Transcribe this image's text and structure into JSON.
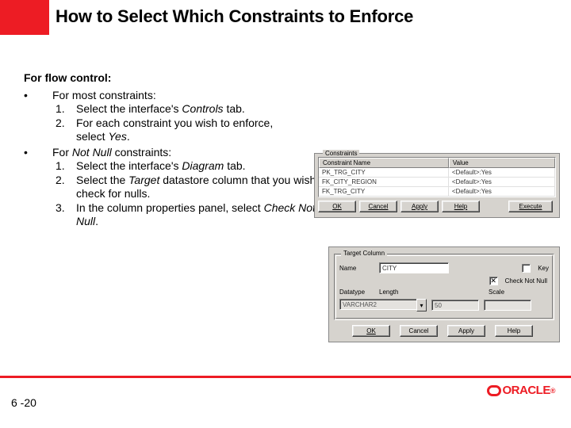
{
  "title": "How to Select Which Constraints to Enforce",
  "section_flow": "For flow control:",
  "bullet_a_label": "•",
  "bullet_a_text": "For most constraints:",
  "list_a": [
    {
      "n": "1.",
      "text_pre": "Select the interface's ",
      "text_em": "Controls",
      "text_post": " tab."
    },
    {
      "n": "2.",
      "text_pre": "For each constraint you wish to enforce, select ",
      "text_em": "Yes",
      "text_post": "."
    }
  ],
  "bullet_b_label": "•",
  "bullet_b_pre": "For ",
  "bullet_b_em": "Not Null",
  "bullet_b_post": " constraints:",
  "list_b": [
    {
      "n": "1.",
      "text_pre": "Select the interface's ",
      "text_em": "Diagram",
      "text_post": " tab."
    },
    {
      "n": "2.",
      "text_pre": "Select the ",
      "text_em": "Target",
      "text_post": " datastore column that you wish to check for nulls."
    },
    {
      "n": "3.",
      "text_pre": "In the column properties panel, select ",
      "text_em": "Check Not Null",
      "text_post": "."
    }
  ],
  "constraints": {
    "group_label": "Constraints",
    "headers": {
      "name": "Constraint Name",
      "value": "Value"
    },
    "rows": [
      {
        "name": "PK_TRG_CITY",
        "value": "<Default>:Yes"
      },
      {
        "name": "FK_CITY_REGION",
        "value": "<Default>:Yes"
      },
      {
        "name": "FK_TRG_CITY",
        "value": "<Default>:Yes"
      }
    ],
    "buttons": {
      "ok": "OK",
      "cancel": "Cancel",
      "apply": "Apply",
      "help": "Help",
      "execute": "Execute"
    }
  },
  "target": {
    "group_label": "Target Column",
    "name_label": "Name",
    "name_value": "CITY",
    "key_label": "Key",
    "key_checked": false,
    "cnn_label": "Check Not Null",
    "cnn_checked": true,
    "datatype_label": "Datatype",
    "datatype_value": "VARCHAR2",
    "length_label": "Length",
    "length_value": "50",
    "scale_label": "Scale",
    "scale_value": "",
    "buttons": {
      "ok": "OK",
      "cancel": "Cancel",
      "apply": "Apply",
      "help": "Help"
    }
  },
  "footer": {
    "page": "6 -20",
    "logo_text": "ORACLE"
  }
}
